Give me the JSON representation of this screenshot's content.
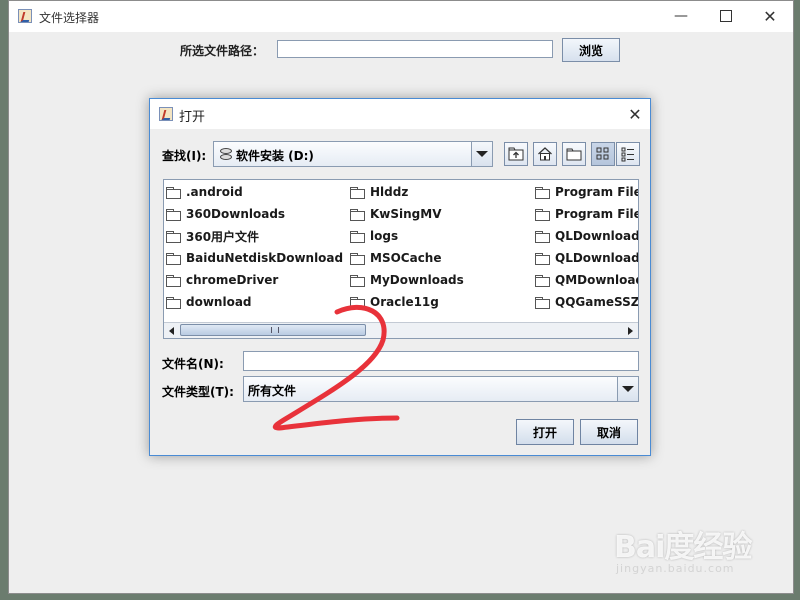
{
  "main_window": {
    "title": "文件选择器",
    "controls": {
      "minimize": "—",
      "close": "✕"
    },
    "path_label": "所选文件路径：",
    "path_value": "",
    "browse_label": "浏览"
  },
  "dialog": {
    "title": "打开",
    "close": "✕",
    "look_in_label": "查找(I):",
    "look_in_value": "软件安装 (D:)",
    "toolbar": [
      "up-one-level-icon",
      "home-icon",
      "new-folder-icon",
      "list-view-icon",
      "details-view-icon"
    ],
    "files": [
      [
        ".android",
        "360Downloads",
        "360用户文件",
        "BaiduNetdiskDownload",
        "chromeDriver",
        "download"
      ],
      [
        "Hlddz",
        "KwSingMV",
        "logs",
        "MSOCache",
        "MyDownloads",
        "Oracle11g"
      ],
      [
        "Program Files",
        "Program Files (",
        "QLDownload",
        "QLDownloadGa",
        "QMDownload",
        "QQGameSSZB"
      ]
    ],
    "file_name_label": "文件名(N):",
    "file_name_value": "",
    "file_type_label": "文件类型(T):",
    "file_type_value": "所有文件",
    "open_label": "打开",
    "cancel_label": "取消"
  },
  "watermark": {
    "logo": "Bai度经验",
    "sub": "jingyan.baidu.com"
  },
  "colors": {
    "dialog_border": "#4a8bd4",
    "annotation": "#e8323a"
  }
}
